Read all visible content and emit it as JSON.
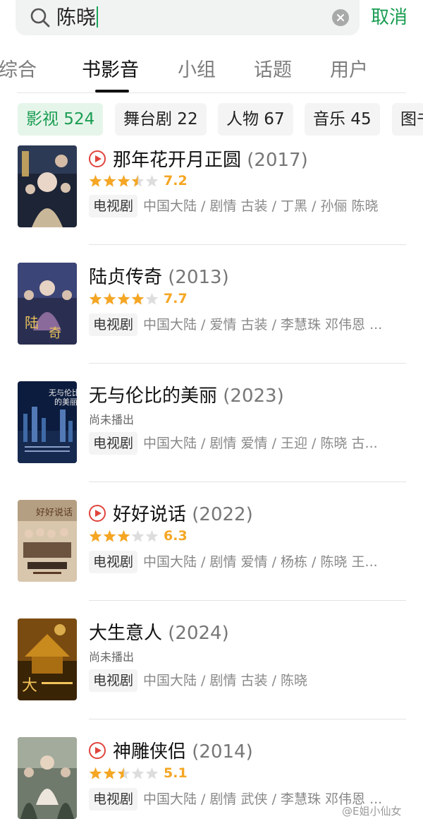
{
  "search": {
    "query": "陈晓",
    "cancel_label": "取消"
  },
  "tabs": [
    {
      "label": "综合",
      "active": false
    },
    {
      "label": "书影音",
      "active": true
    },
    {
      "label": "小组",
      "active": false
    },
    {
      "label": "话题",
      "active": false
    },
    {
      "label": "用户",
      "active": false
    }
  ],
  "filters": [
    {
      "label": "影视 524",
      "active": true
    },
    {
      "label": "舞台剧 22",
      "active": false
    },
    {
      "label": "人物 67",
      "active": false
    },
    {
      "label": "音乐 45",
      "active": false
    },
    {
      "label": "图书",
      "active": false
    }
  ],
  "results": [
    {
      "title": "那年花开月正圆",
      "year": "(2017)",
      "playable": true,
      "stars": 3.5,
      "rating": "7.2",
      "status": "",
      "type": "电视剧",
      "meta": "中国大陆 / 剧情 古装 / 丁黑 / 孙俪 陈晓"
    },
    {
      "title": "陆贞传奇",
      "year": "(2013)",
      "playable": false,
      "stars": 4,
      "rating": "7.7",
      "status": "",
      "type": "电视剧",
      "meta": "中国大陆 / 爱情 古装 / 李慧珠 邓伟恩 ..."
    },
    {
      "title": "无与伦比的美丽",
      "year": "(2023)",
      "playable": false,
      "stars": null,
      "rating": "",
      "status": "尚未播出",
      "type": "电视剧",
      "meta": "中国大陆 / 剧情 爱情 / 王迎 / 陈晓 古..."
    },
    {
      "title": "好好说话",
      "year": "(2022)",
      "playable": true,
      "stars": 3,
      "rating": "6.3",
      "status": "",
      "type": "电视剧",
      "meta": "中国大陆 / 剧情 爱情 / 杨栋 / 陈晓 王..."
    },
    {
      "title": "大生意人",
      "year": "(2024)",
      "playable": false,
      "stars": null,
      "rating": "",
      "status": "尚未播出",
      "type": "电视剧",
      "meta": "中国大陆 / 剧情 古装 / 陈晓"
    },
    {
      "title": "神雕侠侣",
      "year": "(2014)",
      "playable": true,
      "stars": 2.5,
      "rating": "5.1",
      "status": "",
      "type": "电视剧",
      "meta": "中国大陆 / 剧情 武侠 / 李慧珠 邓伟恩 ..."
    }
  ],
  "watermark": "@E姐小仙女",
  "colors": {
    "accent": "#1a9d52",
    "star": "#f5a623",
    "play": "#e0443d"
  }
}
